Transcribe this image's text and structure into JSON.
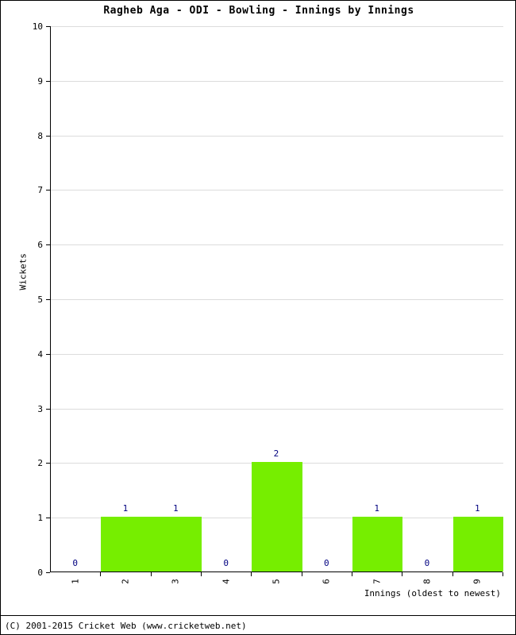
{
  "chart_data": {
    "type": "bar",
    "title": "Ragheb Aga - ODI - Bowling - Innings by Innings",
    "xlabel": "Innings (oldest to newest)",
    "ylabel": "Wickets",
    "categories": [
      "1",
      "2",
      "3",
      "4",
      "5",
      "6",
      "7",
      "8",
      "9"
    ],
    "values": [
      0,
      1,
      1,
      0,
      2,
      0,
      1,
      0,
      1
    ],
    "data_labels": [
      "0",
      "1",
      "1",
      "0",
      "2",
      "0",
      "1",
      "0",
      "1"
    ],
    "ylim": [
      0,
      10
    ],
    "y_ticks": [
      "0",
      "1",
      "2",
      "3",
      "4",
      "5",
      "6",
      "7",
      "8",
      "9",
      "10"
    ],
    "grid": true,
    "legend": "none",
    "bar_color": "#76ee00",
    "label_color": "#000080",
    "axis_color": "#000000",
    "grid_color": "#dcdcdc"
  },
  "footer": {
    "copyright": "(C) 2001-2015 Cricket Web (www.cricketweb.net)"
  }
}
